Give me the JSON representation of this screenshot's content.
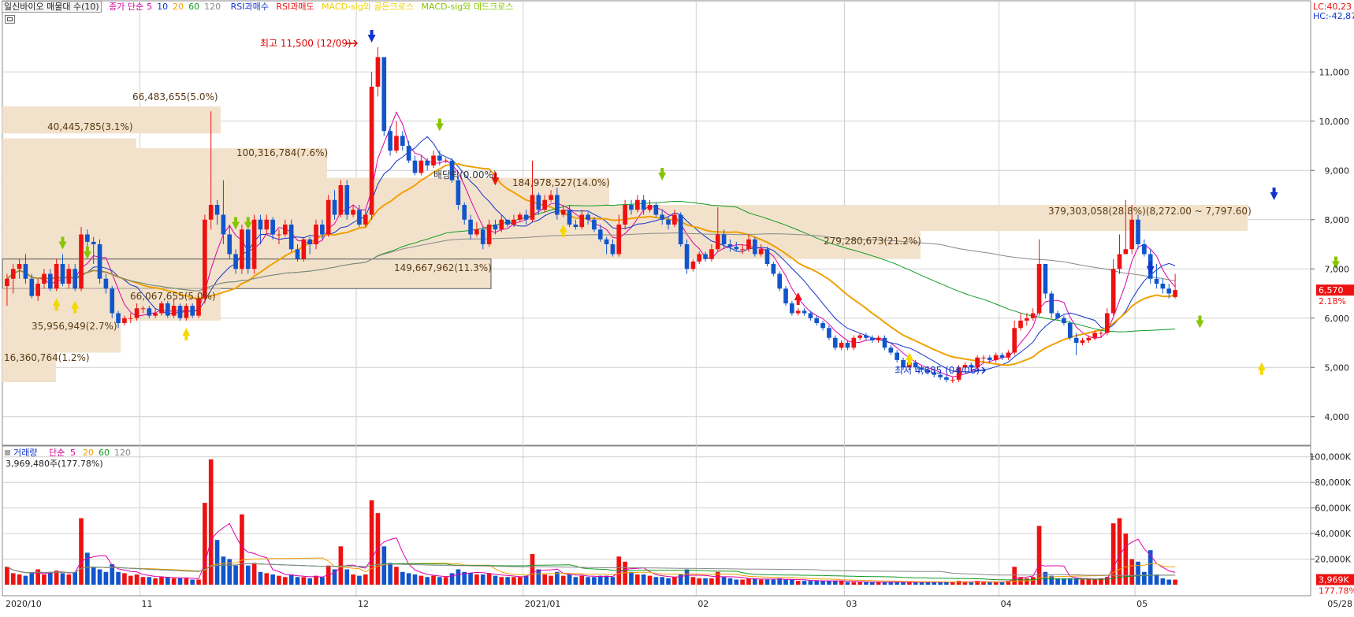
{
  "header": {
    "stock_name": "일신바이오 매물대 수(10)",
    "ma_label": "종가 단순",
    "ma_periods": [
      "5",
      "10",
      "20",
      "60",
      "120"
    ],
    "rsi_buy": "RSI과매수",
    "rsi_sell": "RSI과매도",
    "macd_golden": "MACD-sig와 골든크로스",
    "macd_dead": "MACD-sig와 데드크로스"
  },
  "right_info": {
    "lc": "LC:40,23",
    "hc": "HC:-42,87"
  },
  "colors": {
    "up": "#ee1111",
    "down": "#1155cc",
    "ma5": "#dd00aa",
    "ma10": "#1133cc",
    "ma20": "#f0a000",
    "ma60": "#119922",
    "ma120": "#888888",
    "volume_profile": "#f2e2cc",
    "grid": "#d0d0d0"
  },
  "price_axis": {
    "ticks": [
      "11,000",
      "10,000",
      "9,000",
      "8,000",
      "7,000",
      "6,000",
      "5,000",
      "4,000"
    ]
  },
  "volume_axis": {
    "ticks": [
      "100,000K",
      "80,000K",
      "60,000K",
      "40,000K",
      "20,000K"
    ]
  },
  "current_price": {
    "label": "6,570",
    "change": "2.18%"
  },
  "current_volume": {
    "label": "3,969K",
    "change": "177.78%"
  },
  "date_axis": {
    "labels": [
      "2020/10",
      "11",
      "12",
      "2021/01",
      "02",
      "03",
      "04",
      "05",
      "05/28"
    ]
  },
  "annotations": {
    "high": "최고 11,500 (12/09)",
    "low": "최저 4,685 (04/06)",
    "dividend": "배당락(0.00%)"
  },
  "volume_profile_labels": [
    "66,483,655(5.0%)",
    "40,445,785(3.1%)",
    "100,316,784(7.6%)",
    "184,978,527(14.0%)",
    "379,303,058(28.8%)(8,272.00 ~ 7,797.60)",
    "279,280,673(21.2%)",
    "149,667,962(11.3%)",
    "66,067,655(5.0%)",
    "35,956,949(2.7%)",
    "16,360,764(1.2%)"
  ],
  "volume_panel": {
    "legend_title": "거래량",
    "ma_label": "단순",
    "ma_periods": [
      "5",
      "20",
      "60",
      "120"
    ],
    "value_label": "3,969,480주(177.78%)"
  },
  "chart_data": {
    "type": "candlestick",
    "title": "일신바이오",
    "period": "2020/10 ~ 2021/05/28",
    "price_range": [
      3500,
      12300
    ],
    "volume_range": [
      0,
      106000
    ],
    "volume_unit": "K shares",
    "high": {
      "value": 11500,
      "date": "12/09"
    },
    "low": {
      "value": 4685,
      "date": "04/06"
    },
    "last": {
      "close": 6570,
      "change_pct": 2.18,
      "volume_k": 3969
    },
    "candles": [
      [
        6650,
        6800,
        6250,
        6900,
        14000
      ],
      [
        6800,
        7000,
        6500,
        7100,
        9000
      ],
      [
        7000,
        7100,
        6800,
        7200,
        8000
      ],
      [
        7100,
        6800,
        6700,
        7300,
        7000
      ],
      [
        6800,
        6450,
        6400,
        6900,
        9000
      ],
      [
        6450,
        6700,
        6350,
        6800,
        12000
      ],
      [
        6700,
        6900,
        6600,
        7000,
        8000
      ],
      [
        6900,
        6600,
        6550,
        7000,
        10000
      ],
      [
        6600,
        7100,
        6550,
        7200,
        11000
      ],
      [
        7100,
        6700,
        6650,
        7300,
        9000
      ],
      [
        6700,
        7000,
        6600,
        7100,
        8000
      ],
      [
        7000,
        6600,
        6550,
        7100,
        10000
      ],
      [
        6600,
        7700,
        6550,
        7850,
        52000
      ],
      [
        7700,
        7550,
        7300,
        7800,
        25000
      ],
      [
        7550,
        7500,
        7100,
        7650,
        14000
      ],
      [
        7500,
        6800,
        6700,
        7600,
        12000
      ],
      [
        6800,
        6600,
        6500,
        6900,
        10000
      ],
      [
        6600,
        6100,
        6000,
        6650,
        16000
      ],
      [
        6100,
        5900,
        5800,
        6150,
        10000
      ],
      [
        5900,
        6000,
        5850,
        6050,
        9000
      ],
      [
        6000,
        6000,
        5900,
        6100,
        7000
      ],
      [
        6000,
        6200,
        5950,
        6300,
        8000
      ],
      [
        6200,
        6200,
        6100,
        6250,
        6000
      ],
      [
        6200,
        6050,
        6000,
        6250,
        6000
      ],
      [
        6050,
        6100,
        6000,
        6200,
        5000
      ],
      [
        6100,
        6300,
        6050,
        6350,
        6000
      ],
      [
        6300,
        6050,
        6000,
        6350,
        6000
      ],
      [
        6050,
        6250,
        6000,
        6400,
        5000
      ],
      [
        6250,
        6000,
        5950,
        6300,
        5000
      ],
      [
        6000,
        6250,
        5950,
        6300,
        5000
      ],
      [
        6250,
        6050,
        6000,
        6300,
        4000
      ],
      [
        6050,
        6400,
        6000,
        6450,
        4000
      ],
      [
        6400,
        8000,
        6300,
        8100,
        64000
      ],
      [
        8000,
        8300,
        7800,
        10200,
        98000
      ],
      [
        8300,
        8100,
        7900,
        8400,
        35000
      ],
      [
        8100,
        7700,
        7500,
        8800,
        22000
      ],
      [
        7700,
        7300,
        7200,
        7900,
        20000
      ],
      [
        7300,
        7000,
        6900,
        7400,
        15000
      ],
      [
        7000,
        7800,
        6900,
        7900,
        55000
      ],
      [
        7800,
        7000,
        6900,
        7800,
        15000
      ],
      [
        7000,
        8000,
        6900,
        8100,
        17000
      ],
      [
        8000,
        7800,
        7500,
        8100,
        10000
      ],
      [
        7800,
        8000,
        7700,
        8100,
        9000
      ],
      [
        8000,
        7700,
        7600,
        8050,
        8000
      ],
      [
        7700,
        7700,
        7500,
        7800,
        7000
      ],
      [
        7700,
        7900,
        7650,
        8000,
        6000
      ],
      [
        7900,
        7400,
        7350,
        8000,
        8000
      ],
      [
        7400,
        7200,
        7150,
        7500,
        6000
      ],
      [
        7200,
        7600,
        7150,
        7650,
        6000
      ],
      [
        7600,
        7500,
        7300,
        7650,
        5000
      ],
      [
        7500,
        7900,
        7400,
        8000,
        7000
      ],
      [
        7900,
        7700,
        7600,
        8000,
        6000
      ],
      [
        7700,
        8400,
        7650,
        8500,
        15000
      ],
      [
        8400,
        8100,
        8000,
        8600,
        12000
      ],
      [
        8100,
        8700,
        8050,
        8800,
        30000
      ],
      [
        8700,
        8100,
        8000,
        8800,
        12000
      ],
      [
        8100,
        8200,
        8050,
        8300,
        8000
      ],
      [
        8200,
        7900,
        7850,
        8300,
        7000
      ],
      [
        7900,
        8100,
        7850,
        8200,
        8000
      ],
      [
        8100,
        10700,
        8000,
        11000,
        66000
      ],
      [
        10700,
        11300,
        10500,
        11500,
        56000
      ],
      [
        11300,
        9800,
        9700,
        11300,
        30000
      ],
      [
        9800,
        9400,
        9300,
        9900,
        17000
      ],
      [
        9400,
        9700,
        9350,
        10000,
        14000
      ],
      [
        9700,
        9500,
        9400,
        9800,
        10000
      ],
      [
        9500,
        9200,
        9150,
        9600,
        9000
      ],
      [
        9200,
        8950,
        8900,
        9300,
        8000
      ],
      [
        8950,
        9200,
        8900,
        9300,
        7000
      ],
      [
        9200,
        9100,
        9000,
        9250,
        6000
      ],
      [
        9100,
        9300,
        9050,
        9400,
        7000
      ],
      [
        9300,
        9200,
        9100,
        9400,
        6000
      ],
      [
        9200,
        9200,
        9150,
        9250,
        6000
      ],
      [
        9200,
        8800,
        8750,
        9250,
        9000
      ],
      [
        8800,
        8300,
        8200,
        8900,
        12000
      ],
      [
        8300,
        8000,
        7900,
        8350,
        10000
      ],
      [
        8000,
        7700,
        7600,
        8100,
        9000
      ],
      [
        7700,
        7800,
        7650,
        7950,
        8000
      ],
      [
        7800,
        7500,
        7400,
        7850,
        8000
      ],
      [
        7500,
        7900,
        7450,
        8000,
        9000
      ],
      [
        7900,
        7800,
        7700,
        8000,
        7000
      ],
      [
        7800,
        8000,
        7750,
        8100,
        6000
      ],
      [
        8000,
        7900,
        7850,
        8000,
        6000
      ],
      [
        7900,
        8000,
        7850,
        8100,
        6000
      ],
      [
        8000,
        8100,
        7950,
        8150,
        6000
      ],
      [
        8100,
        8000,
        7900,
        8200,
        7000
      ],
      [
        8000,
        8500,
        7950,
        9200,
        24000
      ],
      [
        8500,
        8200,
        8100,
        8550,
        12000
      ],
      [
        8200,
        8400,
        8150,
        8500,
        8000
      ],
      [
        8400,
        8500,
        8350,
        8600,
        7000
      ],
      [
        8500,
        8100,
        8000,
        8650,
        10000
      ],
      [
        8100,
        8200,
        8050,
        8300,
        7000
      ],
      [
        8200,
        7900,
        7850,
        8300,
        8000
      ],
      [
        7900,
        7850,
        7800,
        8000,
        6000
      ],
      [
        7850,
        8100,
        7800,
        8200,
        7000
      ],
      [
        8100,
        8000,
        7900,
        8150,
        6000
      ],
      [
        8000,
        7800,
        7750,
        8050,
        6000
      ],
      [
        7800,
        7600,
        7550,
        7900,
        7000
      ],
      [
        7600,
        7500,
        7300,
        7650,
        7000
      ],
      [
        7500,
        7300,
        7250,
        7600,
        6000
      ],
      [
        7300,
        7900,
        7250,
        8100,
        22000
      ],
      [
        7900,
        8300,
        7800,
        8400,
        18000
      ],
      [
        8300,
        8200,
        8100,
        8400,
        10000
      ],
      [
        8200,
        8400,
        8150,
        8500,
        8000
      ],
      [
        8400,
        8200,
        8100,
        8500,
        8000
      ],
      [
        8200,
        8300,
        8150,
        8400,
        7000
      ],
      [
        8300,
        8100,
        8050,
        8350,
        6000
      ],
      [
        8100,
        8000,
        7900,
        8200,
        6000
      ],
      [
        8000,
        7900,
        7800,
        8050,
        5000
      ],
      [
        7900,
        8100,
        7850,
        8200,
        6000
      ],
      [
        8100,
        7500,
        7450,
        8150,
        8000
      ],
      [
        7500,
        7000,
        6900,
        7600,
        12000
      ],
      [
        7000,
        7150,
        6950,
        7200,
        6000
      ],
      [
        7150,
        7300,
        7100,
        7350,
        5000
      ],
      [
        7300,
        7200,
        7150,
        7350,
        5000
      ],
      [
        7200,
        7400,
        7150,
        7500,
        5000
      ],
      [
        7400,
        7700,
        7350,
        8250,
        10000
      ],
      [
        7700,
        7500,
        7400,
        7800,
        6000
      ],
      [
        7500,
        7450,
        7350,
        7600,
        5000
      ],
      [
        7450,
        7400,
        7350,
        7550,
        4000
      ],
      [
        7400,
        7400,
        7300,
        7500,
        4000
      ],
      [
        7400,
        7600,
        7350,
        7700,
        5000
      ],
      [
        7600,
        7300,
        7250,
        7650,
        5000
      ],
      [
        7300,
        7400,
        7250,
        7500,
        4000
      ],
      [
        7400,
        7100,
        7050,
        7450,
        4000
      ],
      [
        7100,
        6900,
        6850,
        7150,
        4000
      ],
      [
        6900,
        6600,
        6550,
        6950,
        5000
      ],
      [
        6600,
        6300,
        6250,
        6650,
        4000
      ],
      [
        6300,
        6100,
        6050,
        6350,
        4000
      ],
      [
        6100,
        6150,
        6050,
        6200,
        3000
      ],
      [
        6150,
        6100,
        6050,
        6200,
        3000
      ],
      [
        6100,
        6000,
        5950,
        6150,
        3000
      ],
      [
        6000,
        5900,
        5850,
        6050,
        3000
      ],
      [
        5900,
        5800,
        5750,
        5950,
        3000
      ],
      [
        5800,
        5600,
        5550,
        5850,
        3000
      ],
      [
        5600,
        5400,
        5350,
        5650,
        3000
      ],
      [
        5400,
        5500,
        5350,
        5550,
        3000
      ],
      [
        5500,
        5400,
        5350,
        5550,
        2000
      ],
      [
        5400,
        5600,
        5350,
        5650,
        2000
      ],
      [
        5600,
        5650,
        5550,
        5700,
        2000
      ],
      [
        5650,
        5600,
        5550,
        5700,
        2000
      ],
      [
        5600,
        5550,
        5500,
        5650,
        2000
      ],
      [
        5550,
        5600,
        5500,
        5650,
        2000
      ],
      [
        5600,
        5400,
        5350,
        5650,
        2000
      ],
      [
        5400,
        5300,
        5250,
        5450,
        2000
      ],
      [
        5300,
        5150,
        5100,
        5350,
        2000
      ],
      [
        5150,
        5000,
        4950,
        5200,
        2000
      ],
      [
        5000,
        5100,
        4950,
        5150,
        2000
      ],
      [
        5100,
        5000,
        4950,
        5150,
        2000
      ],
      [
        5000,
        4950,
        4900,
        5050,
        2000
      ],
      [
        4950,
        4900,
        4850,
        5000,
        2000
      ],
      [
        4900,
        4850,
        4800,
        4950,
        2000
      ],
      [
        4850,
        4800,
        4750,
        4900,
        2000
      ],
      [
        4800,
        4750,
        4700,
        4850,
        2000
      ],
      [
        4750,
        4750,
        4685,
        4800,
        2000
      ],
      [
        4750,
        5000,
        4700,
        5050,
        3000
      ],
      [
        5000,
        5050,
        4950,
        5100,
        2000
      ],
      [
        5050,
        5000,
        4950,
        5100,
        2000
      ],
      [
        5000,
        5200,
        4950,
        5250,
        3000
      ],
      [
        5200,
        5200,
        5100,
        5250,
        2000
      ],
      [
        5200,
        5150,
        5100,
        5250,
        2000
      ],
      [
        5150,
        5250,
        5100,
        5300,
        2000
      ],
      [
        5250,
        5200,
        5150,
        5300,
        2000
      ],
      [
        5200,
        5300,
        5150,
        5350,
        3000
      ],
      [
        5300,
        5800,
        5250,
        5950,
        14000
      ],
      [
        5800,
        5950,
        5750,
        6100,
        6000
      ],
      [
        5950,
        6000,
        5850,
        6100,
        5000
      ],
      [
        6000,
        6100,
        5950,
        6200,
        6000
      ],
      [
        6100,
        7100,
        6050,
        7600,
        46000
      ],
      [
        7100,
        6500,
        6400,
        7100,
        10000
      ],
      [
        6500,
        6100,
        6000,
        6550,
        7000
      ],
      [
        6100,
        6000,
        5950,
        6150,
        5000
      ],
      [
        6000,
        5900,
        5850,
        6050,
        5000
      ],
      [
        5900,
        5600,
        5550,
        5950,
        5000
      ],
      [
        5600,
        5500,
        5250,
        5700,
        5000
      ],
      [
        5500,
        5550,
        5450,
        5600,
        4000
      ],
      [
        5550,
        5600,
        5500,
        5650,
        4000
      ],
      [
        5600,
        5700,
        5550,
        5750,
        4000
      ],
      [
        5700,
        5700,
        5600,
        5750,
        5000
      ],
      [
        5700,
        6100,
        5650,
        6200,
        6000
      ],
      [
        6100,
        7000,
        6050,
        7200,
        48000
      ],
      [
        7000,
        7300,
        6900,
        7700,
        52000
      ],
      [
        7300,
        7400,
        7300,
        8400,
        40000
      ],
      [
        7400,
        8000,
        7300,
        8300,
        20000
      ],
      [
        8000,
        7500,
        7400,
        8100,
        18000
      ],
      [
        7500,
        7300,
        7250,
        7600,
        10000
      ],
      [
        7300,
        6800,
        6700,
        7400,
        27000
      ],
      [
        6800,
        6700,
        6600,
        7100,
        8000
      ],
      [
        6700,
        6600,
        6500,
        6800,
        5000
      ],
      [
        6600,
        6500,
        6400,
        6700,
        4000
      ],
      [
        6430,
        6570,
        6400,
        6900,
        3969
      ]
    ],
    "legend": [
      "종가 단순 5",
      "10",
      "20",
      "60",
      "120"
    ]
  }
}
